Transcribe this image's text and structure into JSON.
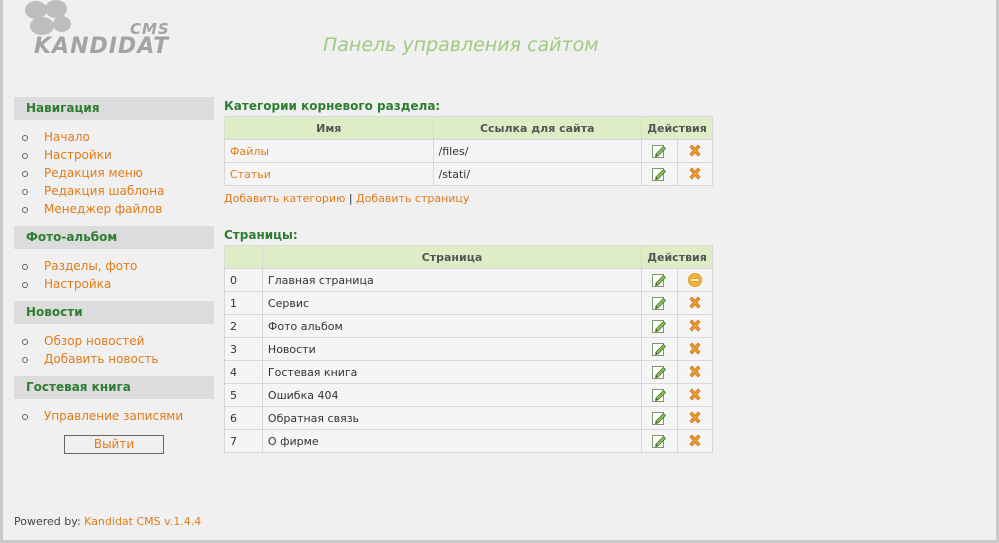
{
  "header": {
    "logo_cms": "CMS",
    "logo_name": "KANDIDAT",
    "title": "Панель управления сайтом"
  },
  "sidebar": {
    "sections": [
      {
        "title": "Навигация",
        "items": [
          "Начало",
          "Настройки",
          "Редакция меню",
          "Редакция шаблона",
          "Менеджер файлов"
        ]
      },
      {
        "title": "Фото-альбом",
        "items": [
          "Разделы, фото",
          "Настройка"
        ]
      },
      {
        "title": "Новости",
        "items": [
          "Обзор новостей",
          "Добавить новость"
        ]
      },
      {
        "title": "Гостевая книга",
        "items": [
          "Управление записями"
        ]
      }
    ],
    "logout_label": "Выйти"
  },
  "footer": {
    "powered_label": "Powered by:",
    "powered_link": "Kandidat CMS v.1.4.4"
  },
  "categories": {
    "title": "Категории корневого раздела:",
    "columns": [
      "Имя",
      "Ссылка для сайта",
      "Действия"
    ],
    "rows": [
      {
        "name": "Файлы",
        "link": "/files/"
      },
      {
        "name": "Статьи",
        "link": "/stati/"
      }
    ],
    "add_category": "Добавить категорию",
    "separator": "|",
    "add_page": "Добавить страницу"
  },
  "pages": {
    "title": "Страницы:",
    "columns": [
      "Страница",
      "Действия"
    ],
    "rows": [
      {
        "id": "0",
        "name": "Главная страница",
        "delete": "disabled"
      },
      {
        "id": "1",
        "name": "Сервис",
        "delete": "delete"
      },
      {
        "id": "2",
        "name": "Фото альбом",
        "delete": "delete"
      },
      {
        "id": "3",
        "name": "Новости",
        "delete": "delete"
      },
      {
        "id": "4",
        "name": "Гостевая книга",
        "delete": "delete"
      },
      {
        "id": "5",
        "name": "Ошибка 404",
        "delete": "delete"
      },
      {
        "id": "6",
        "name": "Обратная связь",
        "delete": "delete"
      },
      {
        "id": "7",
        "name": "О фирме",
        "delete": "delete"
      }
    ]
  },
  "icons": {
    "edit": "edit-pencil-icon",
    "delete": "delete-x-icon",
    "disabled": "no-entry-icon"
  },
  "colors": {
    "accent_green": "#2e7d32",
    "title_green": "#9fcb7f",
    "link_orange": "#e07b1a",
    "table_header": "#dfedc7"
  }
}
